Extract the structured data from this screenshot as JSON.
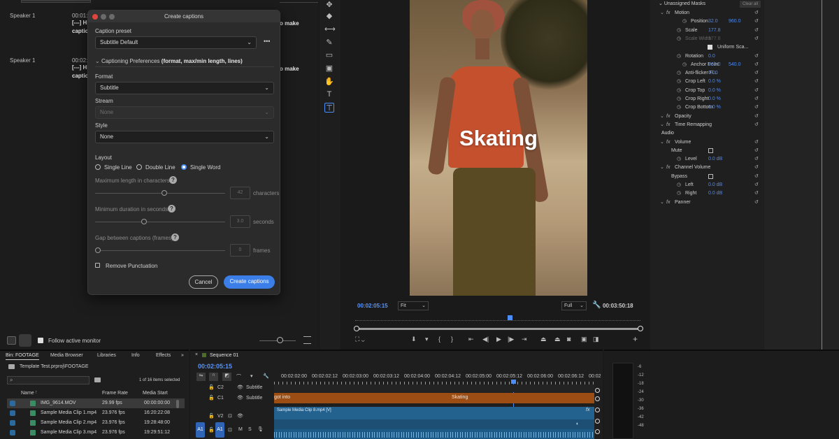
{
  "transcript": [
    {
      "speaker": "Speaker 1",
      "time": "00:01:",
      "text_l1": "[---] Hi",
      "text_l2": "caption",
      "tail": "o make"
    },
    {
      "speaker": "Speaker 1",
      "time": "00:02:",
      "text_l1": "[---] Hi",
      "text_l2": "caption",
      "tail": "o make"
    }
  ],
  "dialog": {
    "title": "Create captions",
    "preset_label": "Caption preset",
    "preset_value": "Subtitle Default",
    "more": "•••",
    "prefs_label": "Captioning Preferences",
    "prefs_hint": "(format, max/min length, lines)",
    "format_label": "Format",
    "format_value": "Subtitle",
    "stream_label": "Stream",
    "stream_value": "None",
    "style_label": "Style",
    "style_value": "None",
    "layout_label": "Layout",
    "layout_options": [
      "Single Line",
      "Double Line",
      "Single Word"
    ],
    "layout_selected": "Single Word",
    "max_len_label": "Maximum length in characters",
    "max_len_value": "42",
    "max_len_unit": "characters",
    "min_dur_label": "Minimum duration in seconds",
    "min_dur_value": "3.0",
    "min_dur_unit": "seconds",
    "gap_label": "Gap between captions (frames)",
    "gap_value": "0",
    "gap_unit": "frames",
    "remove_punct": "Remove Punctuation",
    "cancel": "Cancel",
    "create": "Create captions"
  },
  "follow_monitor": "Follow active monitor",
  "program": {
    "caption": "Skating",
    "timecode": "00:02:05:15",
    "fit": "Fit",
    "quality": "Full",
    "duration": "00:03:50:18"
  },
  "effects": {
    "header": "Unassigned Masks",
    "clear": "Clear all",
    "rows": [
      {
        "label": "Motion",
        "indent": 0,
        "fx": true
      },
      {
        "label": "Position",
        "indent": 2,
        "v1": "32.0",
        "v2": "960.0"
      },
      {
        "label": "Scale",
        "indent": 1,
        "v1": "177.8"
      },
      {
        "label": "Scale Width",
        "indent": 1,
        "v1": "177.8",
        "dim": true
      },
      {
        "label": "Uniform Sca...",
        "indent": 3,
        "check": true
      },
      {
        "label": "Rotation",
        "indent": 1,
        "v1": "0.0"
      },
      {
        "label": "Anchor Point",
        "indent": 2,
        "v1": "960.0",
        "v2": "540.0"
      },
      {
        "label": "Anti-flicker Fi...",
        "indent": 1,
        "v1": "0.00"
      },
      {
        "label": "Crop Left",
        "indent": 1,
        "v1": "0.0 %"
      },
      {
        "label": "Crop Top",
        "indent": 1,
        "v1": "0.0 %"
      },
      {
        "label": "Crop Right",
        "indent": 1,
        "v1": "0.0 %"
      },
      {
        "label": "Crop Bottom",
        "indent": 1,
        "v1": "0.0 %"
      },
      {
        "label": "Opacity",
        "indent": 0,
        "fx": true
      },
      {
        "label": "Time Remapping",
        "indent": 0,
        "fx": true
      },
      {
        "label": "Audio",
        "indent": -1
      },
      {
        "label": "Volume",
        "indent": 0,
        "fx": true
      },
      {
        "label": "Mute",
        "indent": 2,
        "check": true
      },
      {
        "label": "Level",
        "indent": 1,
        "v1": "0.0 dB"
      },
      {
        "label": "Channel Volume",
        "indent": 0,
        "fx": true
      },
      {
        "label": "Bypass",
        "indent": 2,
        "check": true
      },
      {
        "label": "Left",
        "indent": 1,
        "v1": "0.0 dB"
      },
      {
        "label": "Right",
        "indent": 1,
        "v1": "0.0 dB"
      },
      {
        "label": "Panner",
        "indent": 0,
        "fx": true
      }
    ]
  },
  "project": {
    "tabs": [
      "Bin: FOOTAGE",
      "Media Browser",
      "Libraries",
      "Info",
      "Effects"
    ],
    "path": "Template Test.prproj\\FOOTAGE",
    "count": "1 of 16 items selected",
    "cols": [
      "Name",
      "Frame Rate",
      "Media Start"
    ],
    "rows": [
      {
        "name": "IMG_9614.MOV",
        "fps": "29.99 fps",
        "start": "00:00:00:00"
      },
      {
        "name": "Sample Media Clip 1.mp4",
        "fps": "23.976 fps",
        "start": "16:20:22:08"
      },
      {
        "name": "Sample Media Clip 2.mp4",
        "fps": "23.976 fps",
        "start": "19:28:48:00"
      },
      {
        "name": "Sample Media Clip 3.mp4",
        "fps": "23.976 fps",
        "start": "19:29:51:12"
      }
    ]
  },
  "timeline": {
    "seq_tab": "Sequence 01",
    "timecode": "00:02:05:15",
    "ruler": [
      "00:02:02:00",
      "00:02:02:12",
      "00:02:03:00",
      "00:02:03:12",
      "00:02:04:00",
      "00:02:04:12",
      "00:02:05:00",
      "00:02:05:12",
      "00:02:06:00",
      "00:02:06:12",
      "00:02"
    ],
    "tracks": [
      {
        "id": "C2",
        "name": "Subtitle"
      },
      {
        "id": "C1",
        "name": "Subtitle"
      },
      {
        "id": "V2"
      },
      {
        "id": "A1"
      }
    ],
    "cap_left": "got into",
    "cap_mid": "Skating",
    "clip_name": "Sample Media Clip 8.mp4 [V]",
    "meter": [
      "-6",
      "-12",
      "-18",
      "-24",
      "-30",
      "-36",
      "-42",
      "-48"
    ]
  }
}
